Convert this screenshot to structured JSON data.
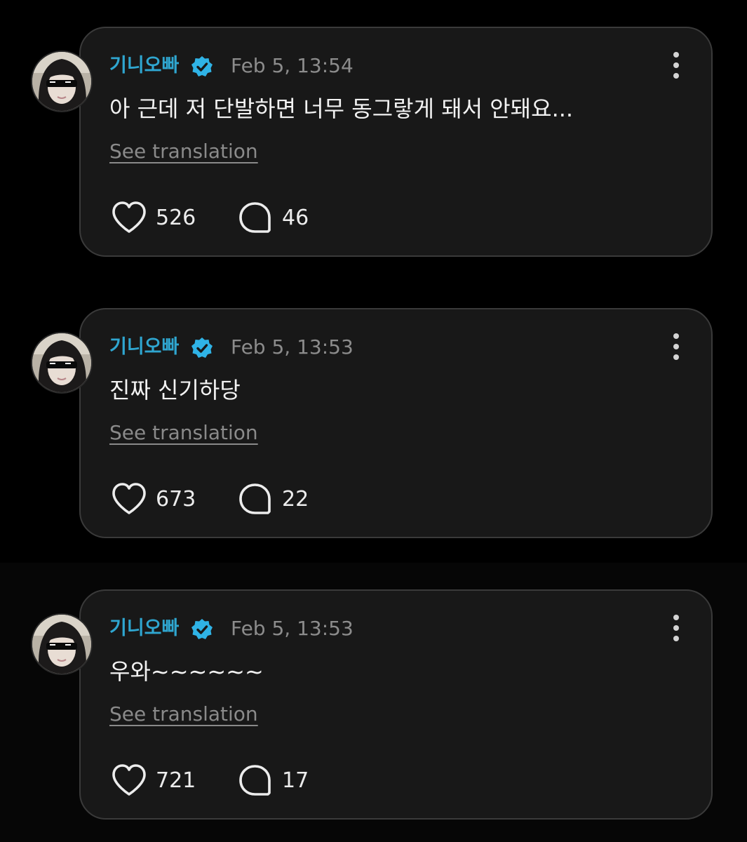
{
  "colors": {
    "background": "#000000",
    "card_background": "#181818",
    "card_border": "#3a3a3a",
    "username": "#2fa6d0",
    "verified_badge": "#2fb3e6",
    "timestamp": "#8c8c8c",
    "body_text": "#f2f2f2",
    "translation_link": "#8a8a8a",
    "counts": "#ececec"
  },
  "icons": {
    "verified": "verified-badge-icon",
    "more": "more-vertical-icon",
    "like": "heart-icon",
    "reply": "speech-bubble-icon"
  },
  "posts": [
    {
      "username": "기니오빠",
      "timestamp": "Feb 5, 13:54",
      "text": "아 근데 저 단발하면 너무 동그랗게 돼서 안돼요...",
      "translation_label": "See translation",
      "likes": "526",
      "replies": "46"
    },
    {
      "username": "기니오빠",
      "timestamp": "Feb 5, 13:53",
      "text": "진짜 신기하당",
      "translation_label": "See translation",
      "likes": "673",
      "replies": "22"
    },
    {
      "username": "기니오빠",
      "timestamp": "Feb 5, 13:53",
      "text": "우와~~~~~~",
      "translation_label": "See translation",
      "likes": "721",
      "replies": "17"
    }
  ]
}
